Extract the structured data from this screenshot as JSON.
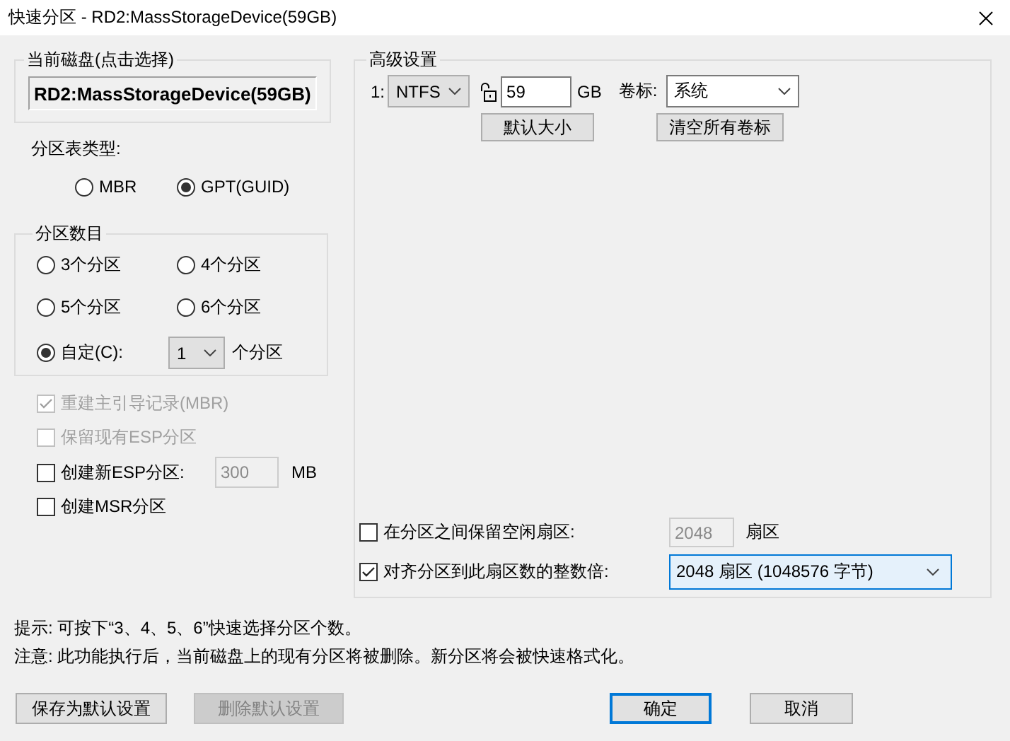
{
  "window": {
    "title": "快速分区 - RD2:MassStorageDevice(59GB)"
  },
  "current_disk": {
    "label": "当前磁盘(点击选择)",
    "value": "RD2:MassStorageDevice(59GB)"
  },
  "partition_table": {
    "label": "分区表类型:",
    "options": [
      {
        "label": "MBR",
        "selected": false
      },
      {
        "label": "GPT(GUID)",
        "selected": true
      }
    ]
  },
  "partition_count": {
    "label": "分区数目",
    "options": [
      {
        "label": "3个分区",
        "selected": false
      },
      {
        "label": "4个分区",
        "selected": false
      },
      {
        "label": "5个分区",
        "selected": false
      },
      {
        "label": "6个分区",
        "selected": false
      },
      {
        "label": "自定(C):",
        "selected": true
      }
    ],
    "custom_value": "1",
    "custom_suffix": "个分区"
  },
  "options": [
    {
      "label": "重建主引导记录(MBR)",
      "checked": true,
      "disabled": true
    },
    {
      "label": "保留现有ESP分区",
      "checked": false,
      "disabled": true
    },
    {
      "label": "创建新ESP分区:",
      "checked": false,
      "disabled": false,
      "value": "300",
      "value_disabled": true,
      "unit": "MB"
    },
    {
      "label": "创建MSR分区",
      "checked": false,
      "disabled": false
    }
  ],
  "advanced": {
    "label": "高级设置",
    "partitions": [
      {
        "index": "1:",
        "filesystem": "NTFS",
        "size": "59",
        "unit": "GB",
        "volume_label_caption": "卷标:",
        "volume_label": "系统"
      }
    ],
    "buttons": [
      "默认大小",
      "清空所有卷标"
    ],
    "reserve_free": {
      "label": "在分区之间保留空闲扇区:",
      "checked": false,
      "value": "2048",
      "value_disabled": true,
      "unit": "扇区"
    },
    "align": {
      "label": "对齐分区到此扇区数的整数倍:",
      "checked": true,
      "value": "2048 扇区 (1048576 字节)"
    }
  },
  "notes": [
    "提示: 可按下“3、4、5、6”快速选择分区个数。",
    "注意: 此功能执行后，当前磁盘上的现有分区将被删除。新分区将会被快速格式化。"
  ],
  "buttons": [
    {
      "label": "保存为默认设置",
      "disabled": false,
      "default": false
    },
    {
      "label": "删除默认设置",
      "disabled": true,
      "default": false
    },
    {
      "label": "确定",
      "disabled": false,
      "default": true
    },
    {
      "label": "取消",
      "disabled": false,
      "default": false
    }
  ]
}
